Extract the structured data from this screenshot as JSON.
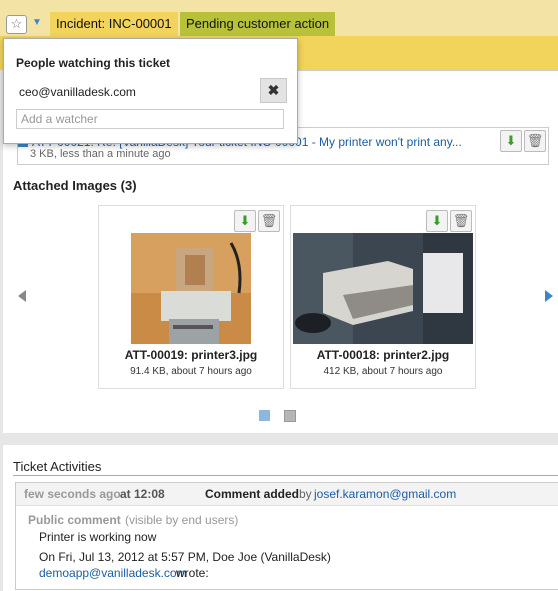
{
  "header": {
    "incident_title": "Incident: INC-00001",
    "status": "Pending customer action"
  },
  "watchers": {
    "title": "People watching this ticket",
    "emails": [
      "ceo@vanilladesk.com"
    ],
    "placeholder": "Add a watcher"
  },
  "attachment": {
    "filename": "ATT-00021: Re: [VanillaDesk] Your ticket INC-00001 - My printer won't print any...",
    "meta": "3 KB, less than a minute ago"
  },
  "attached_images": {
    "title": "Attached Images (3)",
    "items": [
      {
        "name": "ATT-00019: printer3.jpg",
        "meta": "91.4 KB, about 7 hours ago"
      },
      {
        "name": "ATT-00018: printer2.jpg",
        "meta": "412 KB, about 7 hours ago"
      }
    ]
  },
  "activities": {
    "title": "Ticket Activities",
    "entry": {
      "time_relative": "few seconds ago",
      "time_at": "at 12:08",
      "event": "Comment added",
      "by": "by",
      "author": "josef.karamon@gmail.com",
      "visibility": "Public comment",
      "visibility_note": "(visible by end users)",
      "line1": "Printer is working now",
      "line2": "On Fri, Jul 13, 2012 at 5:57 PM, Doe Joe (VanillaDesk)",
      "link": "demoapp@vanilladesk.com",
      "line3": "wrote:"
    }
  },
  "colors": {
    "status_bg": "#b7c23a",
    "header_bg": "#f2d35b",
    "link": "#1a5da8"
  }
}
